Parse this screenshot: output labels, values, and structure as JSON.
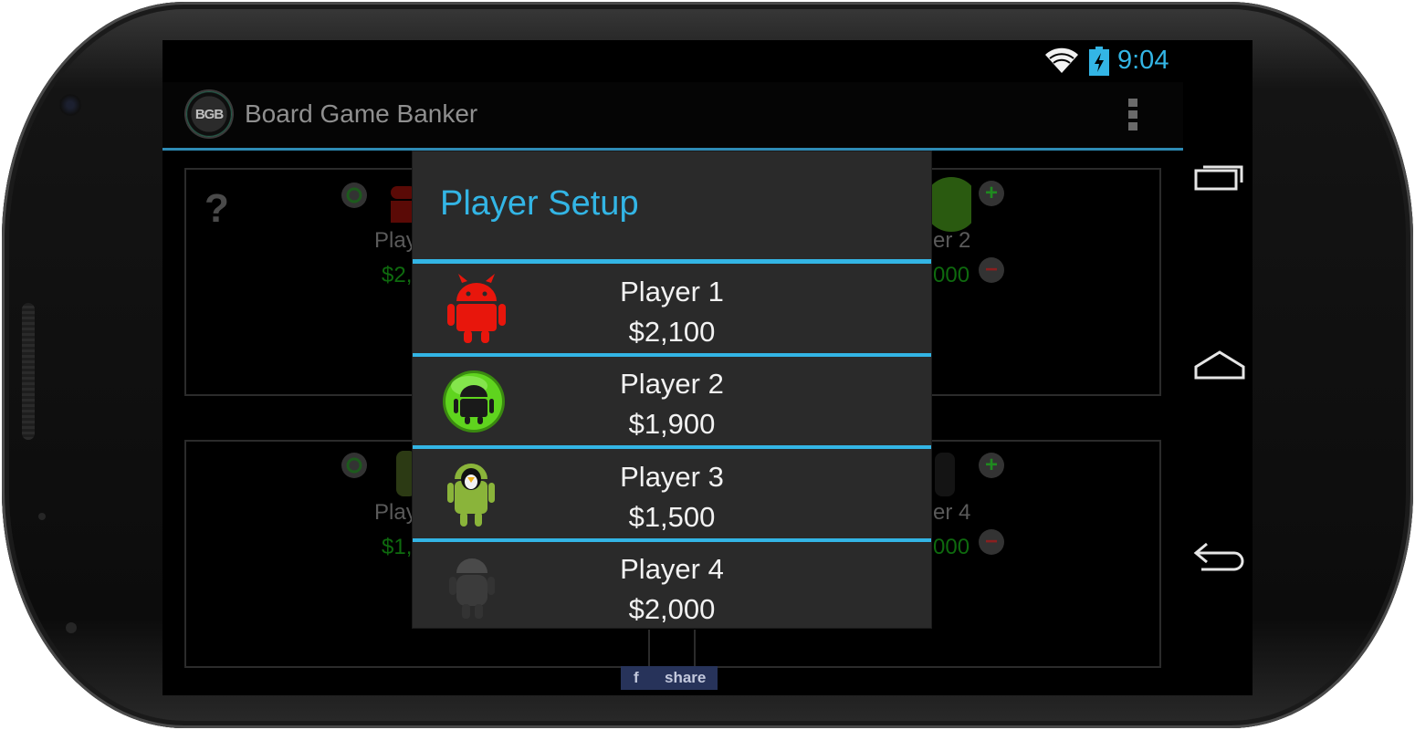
{
  "status_bar": {
    "time": "9:04",
    "wifi_icon": "wifi-icon",
    "battery_icon": "battery-charging-icon",
    "accent_color": "#33b5e5"
  },
  "action_bar": {
    "logo_text": "BGB",
    "title": "Board Game Banker",
    "overflow_icon": "overflow-menu-icon"
  },
  "navigation": {
    "recent_apps_icon": "recent-apps-icon",
    "home_icon": "home-icon",
    "back_icon": "back-icon"
  },
  "background_board": {
    "help_label": "?",
    "tiles": [
      {
        "name_fragment_left": "Play",
        "amount_fragment_left": "$2,",
        "name_fragment_right": "er 2",
        "amount_fragment_right": "000"
      },
      {
        "name_fragment_left": "Play",
        "amount_fragment_left": "$1,",
        "name_fragment_right": "er 4",
        "amount_fragment_right": "000"
      }
    ],
    "plus_label": "+",
    "minus_label": "−",
    "share": {
      "icon_label": "f",
      "label": "share"
    }
  },
  "dialog": {
    "title": "Player Setup",
    "players": [
      {
        "name": "Player 1",
        "amount": "$2,100",
        "icon": "red-devil-android-icon",
        "color": "#e8160c"
      },
      {
        "name": "Player 2",
        "amount": "$1,900",
        "icon": "green-orb-android-icon",
        "color": "#4fc81c"
      },
      {
        "name": "Player 3",
        "amount": "$1,500",
        "icon": "linux-penguin-android-icon",
        "color": "#8ab43a"
      },
      {
        "name": "Player 4",
        "amount": "$2,000",
        "icon": "dark-android-icon",
        "color": "#3b3b3b"
      }
    ]
  }
}
